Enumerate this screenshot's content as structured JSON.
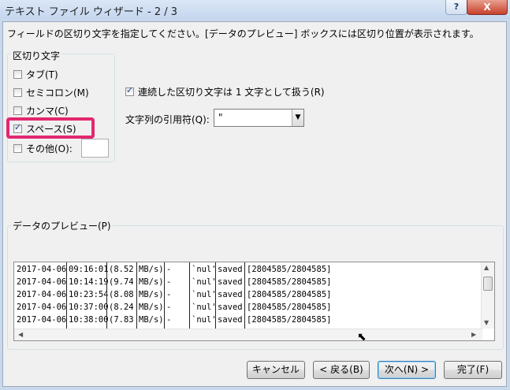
{
  "window": {
    "title": "テキスト ファイル ウィザード - 2 / 3",
    "help_label": "?",
    "close_label": "X"
  },
  "description": "フィールドの区切り文字を指定してください。[データのプレビュー] ボックスには区切り位置が表示されます。",
  "delimiters": {
    "group_title": "区切り文字",
    "tab": {
      "label": "タブ(T)",
      "checked": false
    },
    "semicolon": {
      "label": "セミコロン(M)",
      "checked": false
    },
    "comma": {
      "label": "カンマ(C)",
      "checked": false
    },
    "space": {
      "label": "スペース(S)",
      "checked": true
    },
    "other": {
      "label": "その他(O):",
      "checked": false,
      "value": ""
    }
  },
  "consecutive": {
    "label": "連続した区切り文字は 1 文字として扱う(R)",
    "checked": true
  },
  "text_qualifier": {
    "label": "文字列の引用符(Q):",
    "value": "\""
  },
  "preview": {
    "title": "データのプレビュー(P)",
    "rows": [
      [
        "2017-04-06",
        "09:16:01",
        "(8.52",
        "MB/s)",
        "-",
        "`nul'",
        "saved",
        "[2804585/2804585]"
      ],
      [
        "2017-04-06",
        "10:14:19",
        "(9.74",
        "MB/s)",
        "-",
        "`nul'",
        "saved",
        "[2804585/2804585]"
      ],
      [
        "2017-04-06",
        "10:23:54",
        "(8.08",
        "MB/s)",
        "-",
        "`nul'",
        "saved",
        "[2804585/2804585]"
      ],
      [
        "2017-04-06",
        "10:37:00",
        "(8.24",
        "MB/s)",
        "-",
        "`nul'",
        "saved",
        "[2804585/2804585]"
      ],
      [
        "2017-04-06",
        "10:38:00",
        "(7.83",
        "MB/s)",
        "-",
        "`nul'",
        "saved",
        "[2804585/2804585]"
      ]
    ]
  },
  "buttons": {
    "cancel": "キャンセル",
    "back": "< 戻る(B)",
    "next": "次へ(N) >",
    "finish": "完了(F)"
  }
}
